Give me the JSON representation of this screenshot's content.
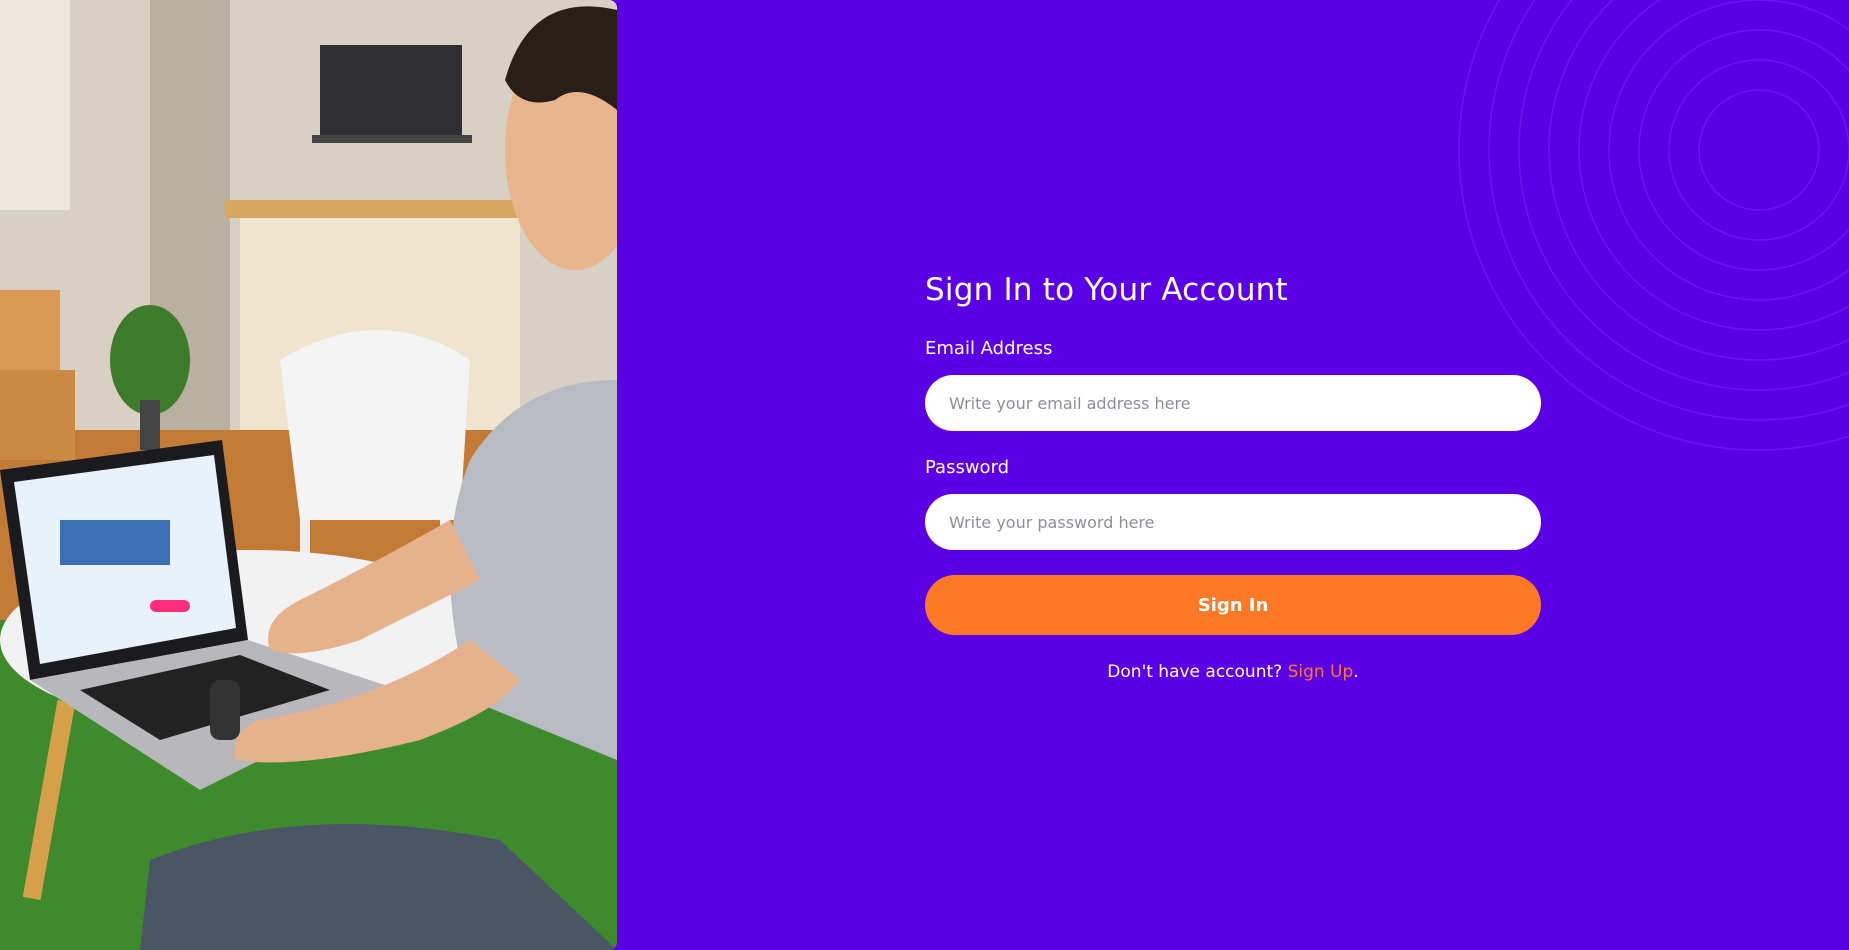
{
  "hero_image": {
    "icon": "person-laptop-photo"
  },
  "form": {
    "title": "Sign In to Your Account",
    "email": {
      "label": "Email Address",
      "placeholder": "Write your email address here"
    },
    "password": {
      "label": "Password",
      "placeholder": "Write your password here"
    },
    "submit_label": "Sign In",
    "signup_prompt": "Don't have account?",
    "signup_link": "Sign Up",
    "signup_suffix": "."
  },
  "colors": {
    "background": "#5b00e5",
    "accent": "#ff7826",
    "text": "#ffffff",
    "input_background": "#ffffff"
  }
}
